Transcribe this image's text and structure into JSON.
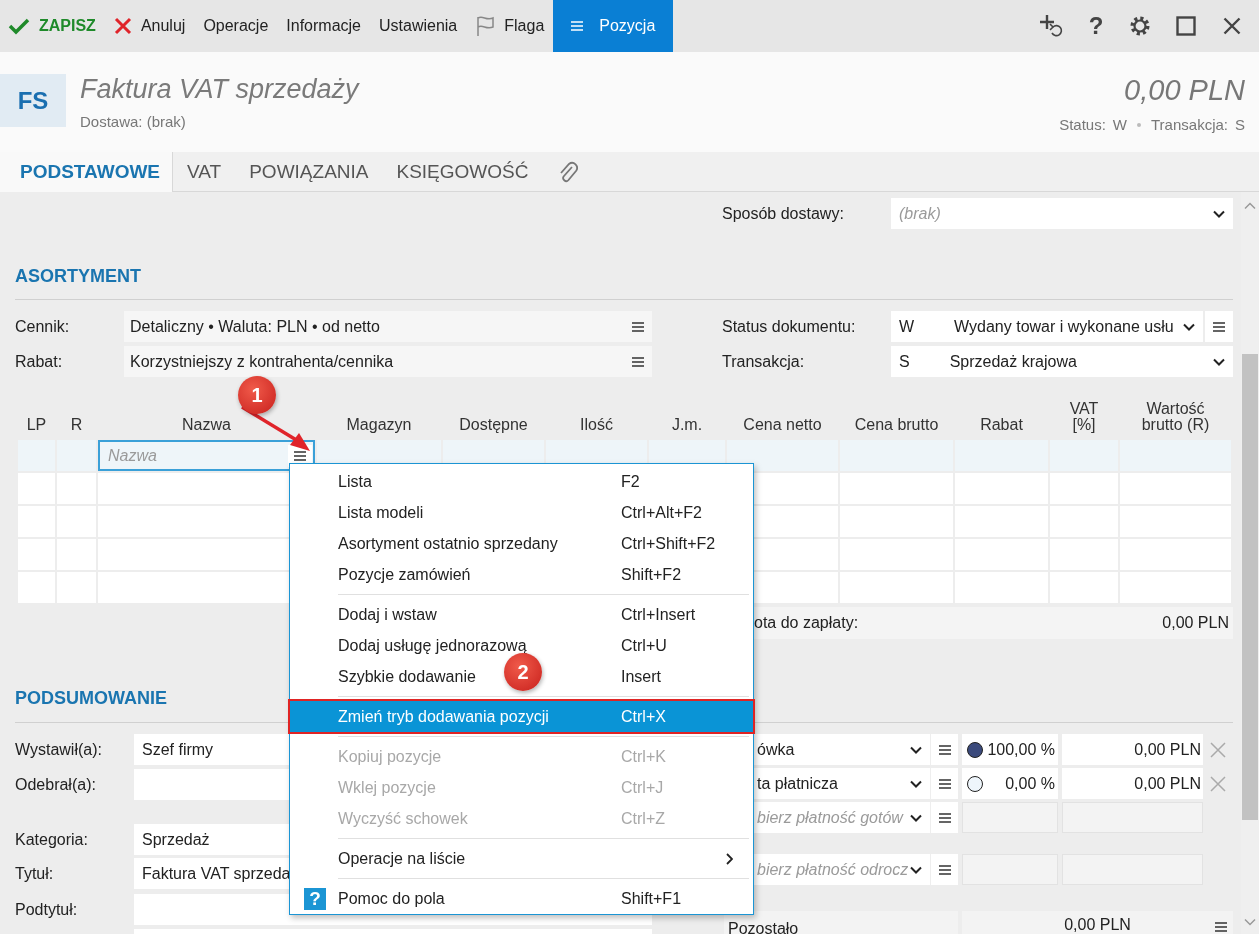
{
  "toolbar": {
    "items": [
      {
        "kind": "save",
        "label": "ZAPISZ",
        "selected": false
      },
      {
        "kind": "cancel",
        "label": "Anuluj",
        "selected": false
      },
      {
        "kind": "plain",
        "label": "Operacje",
        "selected": false
      },
      {
        "kind": "plain",
        "label": "Informacje",
        "selected": false
      },
      {
        "kind": "plain",
        "label": "Ustawienia",
        "selected": false
      },
      {
        "kind": "flag",
        "label": "Flaga",
        "selected": false
      },
      {
        "kind": "menu",
        "label": "Pozycja",
        "selected": true
      }
    ],
    "help_glyph": "?"
  },
  "header": {
    "badge": "FS",
    "title": "Faktura VAT sprzedaży",
    "subtitle": "Dostawa: (brak)",
    "amount": "0,00 PLN",
    "status_label": "Status:",
    "status": "W",
    "transaction_label": "Transakcja:",
    "transaction": "S"
  },
  "tabs": [
    {
      "kind": "text",
      "label": "PODSTAWOWE",
      "selected": true
    },
    {
      "kind": "text",
      "label": "VAT",
      "selected": false
    },
    {
      "kind": "text",
      "label": "POWIĄZANIA",
      "selected": false
    },
    {
      "kind": "text",
      "label": "KSIĘGOWOŚĆ",
      "selected": false
    },
    {
      "kind": "attachment",
      "selected": false
    }
  ],
  "delivery": {
    "label": "Sposób dostawy:",
    "placeholder": "(brak)"
  },
  "assortment": {
    "title": "ASORTYMENT",
    "left_fields": [
      {
        "label": "Cennik:",
        "value": "Detaliczny • Waluta: PLN • od netto"
      },
      {
        "label": "Rabat:",
        "value": "Korzystniejszy z kontrahenta/cennika"
      }
    ],
    "right_fields": [
      {
        "label": "Status dokumentu:",
        "code": "W",
        "value": "Wydany towar i wykonane usłu",
        "has_menu": true
      },
      {
        "label": "Transakcja:",
        "code": "S",
        "value": "Sprzedaż krajowa",
        "has_menu": false
      }
    ],
    "table": {
      "columns": [
        "LP",
        "R",
        "Nazwa",
        "Magazyn",
        "Dostępne",
        "Ilość",
        "J.m.",
        "Cena netto",
        "Cena brutto",
        "Rabat",
        "VAT [%]",
        "Wartość brutto (R)"
      ],
      "rows": [
        {
          "selected": true,
          "name_placeholder": "Nazwa"
        },
        {
          "selected": false
        },
        {
          "selected": false
        },
        {
          "selected": false
        },
        {
          "selected": false
        }
      ]
    },
    "total": {
      "label": "ota do zapłaty:",
      "value": "0,00 PLN"
    }
  },
  "summary": {
    "title": "PODSUMOWANIE",
    "field_groups": [
      [
        {
          "label": "Wystawił(a):",
          "value": "Szef firmy"
        },
        {
          "label": "Odebrał(a):"
        }
      ],
      [
        {
          "label": "Kategoria:",
          "value": "Sprzedaż"
        },
        {
          "label": "Tytuł:",
          "value": "Faktura VAT sprzeda"
        },
        {
          "label": "Podtytuł:"
        }
      ]
    ],
    "payments": [
      {
        "kind": "filled",
        "method": "ówka",
        "selected": true,
        "share": "100,00 %",
        "amount": "0,00 PLN"
      },
      {
        "kind": "filled",
        "method": "ta płatnicza",
        "selected": false,
        "share": "0,00 %",
        "amount": "0,00 PLN"
      },
      {
        "kind": "empty",
        "placeholder": "bierz płatność gotów"
      },
      {
        "kind": "empty",
        "placeholder": "bierz płatność odrocz"
      }
    ],
    "remaining": {
      "label": "Pozostało",
      "value": "0,00 PLN"
    }
  },
  "context_menu": {
    "items": [
      {
        "kind": "item",
        "label": "Lista",
        "shortcut": "F2",
        "disabled": false,
        "selected": false
      },
      {
        "kind": "item",
        "label": "Lista modeli",
        "shortcut": "Ctrl+Alt+F2",
        "disabled": false,
        "selected": false
      },
      {
        "kind": "item",
        "label": "Asortyment ostatnio sprzedany",
        "shortcut": "Ctrl+Shift+F2",
        "disabled": false,
        "selected": false
      },
      {
        "kind": "item",
        "label": "Pozycje zamówień",
        "shortcut": "Shift+F2",
        "disabled": false,
        "selected": false
      },
      {
        "kind": "separator"
      },
      {
        "kind": "item",
        "label": "Dodaj i wstaw",
        "shortcut": "Ctrl+Insert",
        "disabled": false,
        "selected": false
      },
      {
        "kind": "item",
        "label": "Dodaj usługę jednorazową",
        "shortcut": "Ctrl+U",
        "disabled": false,
        "selected": false
      },
      {
        "kind": "item",
        "label": "Szybkie dodawanie",
        "shortcut": "Insert",
        "disabled": false,
        "selected": false
      },
      {
        "kind": "separator"
      },
      {
        "kind": "item",
        "label": "Zmień tryb dodawania pozycji",
        "shortcut": "Ctrl+X",
        "disabled": false,
        "selected": true
      },
      {
        "kind": "separator"
      },
      {
        "kind": "item",
        "label": "Kopiuj pozycje",
        "shortcut": "Ctrl+K",
        "disabled": true,
        "selected": false
      },
      {
        "kind": "item",
        "label": "Wklej pozycje",
        "shortcut": "Ctrl+J",
        "disabled": true,
        "selected": false
      },
      {
        "kind": "item",
        "label": "Wyczyść schowek",
        "shortcut": "Ctrl+Z",
        "disabled": true,
        "selected": false
      },
      {
        "kind": "separator"
      },
      {
        "kind": "submenu",
        "label": "Operacje na liście",
        "disabled": false,
        "selected": false
      },
      {
        "kind": "separator"
      },
      {
        "kind": "help",
        "icon_glyph": "?",
        "label": "Pomoc do pola",
        "shortcut": "Shift+F1",
        "disabled": false,
        "selected": false
      }
    ]
  },
  "annotations": [
    {
      "label": "1"
    },
    {
      "label": "2"
    }
  ]
}
